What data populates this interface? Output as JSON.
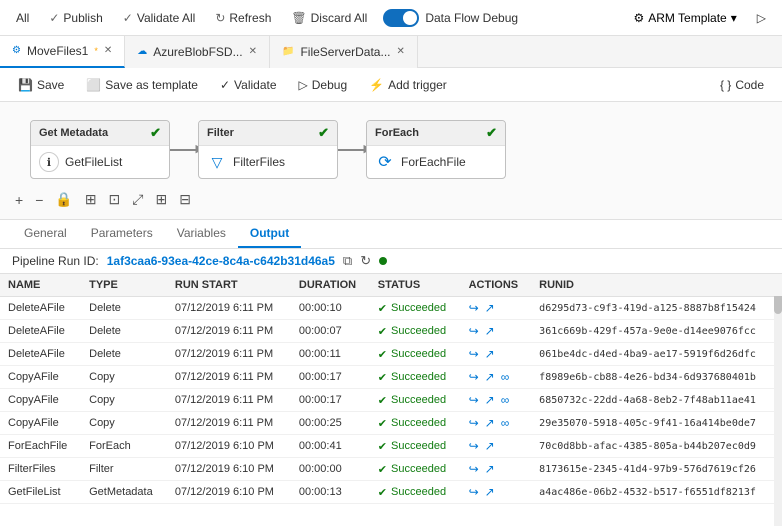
{
  "topToolbar": {
    "items": [
      {
        "label": "All"
      },
      {
        "label": "Publish"
      },
      {
        "label": "Validate All"
      },
      {
        "label": "Refresh"
      },
      {
        "label": "Discard All"
      }
    ],
    "toggle": {
      "label": "Data Flow Debug"
    },
    "armTemplate": {
      "label": "ARM Template"
    },
    "debugIcon": "▶"
  },
  "tabs": [
    {
      "id": "movefile",
      "label": "MoveFiles1",
      "active": true,
      "modified": true
    },
    {
      "id": "azureblob",
      "label": "AzureBlobFSD...",
      "active": false
    },
    {
      "id": "fileserver",
      "label": "FileServerData...",
      "active": false
    }
  ],
  "subToolbar": {
    "save": "Save",
    "saveAsTemplate": "Save as template",
    "validate": "Validate",
    "debug": "Debug",
    "addTrigger": "Add trigger",
    "code": "Code"
  },
  "nodes": [
    {
      "id": "getMetadata",
      "label": "Get Metadata",
      "body": "GetFileList",
      "iconType": "info"
    },
    {
      "id": "filter",
      "label": "Filter",
      "body": "FilterFiles",
      "iconType": "filter"
    },
    {
      "id": "forEach",
      "label": "ForEach",
      "body": "ForEachFile",
      "iconType": "foreach"
    }
  ],
  "canvasTools": [
    "+",
    "−",
    "🔒",
    "⊞",
    "⊡",
    "⤢",
    "⊞",
    "⊟"
  ],
  "panelTabs": [
    {
      "label": "General"
    },
    {
      "label": "Parameters"
    },
    {
      "label": "Variables"
    },
    {
      "label": "Output",
      "active": true
    }
  ],
  "pipelineRunBar": {
    "label": "Pipeline Run ID:",
    "runId": "1af3caa6-93ea-42ce-8c4a-c642b31d46a5"
  },
  "tableHeaders": [
    "NAME",
    "TYPE",
    "RUN START",
    "DURATION",
    "STATUS",
    "ACTIONS",
    "RUNID"
  ],
  "tableRows": [
    {
      "name": "DeleteAFile",
      "type": "Delete",
      "runStart": "07/12/2019 6:11 PM",
      "duration": "00:00:10",
      "status": "Succeeded",
      "runId": "d6295d73-c9f3-419d-a125-8887b8f15424"
    },
    {
      "name": "DeleteAFile",
      "type": "Delete",
      "runStart": "07/12/2019 6:11 PM",
      "duration": "00:00:07",
      "status": "Succeeded",
      "runId": "361c669b-429f-457a-9e0e-d14ee9076fcc"
    },
    {
      "name": "DeleteAFile",
      "type": "Delete",
      "runStart": "07/12/2019 6:11 PM",
      "duration": "00:00:11",
      "status": "Succeeded",
      "runId": "061be4dc-d4ed-4ba9-ae17-5919f6d26dfc"
    },
    {
      "name": "CopyAFile",
      "type": "Copy",
      "runStart": "07/12/2019 6:11 PM",
      "duration": "00:00:17",
      "status": "Succeeded",
      "hasExtra": true,
      "runId": "f8989e6b-cb88-4e26-bd34-6d937680401b"
    },
    {
      "name": "CopyAFile",
      "type": "Copy",
      "runStart": "07/12/2019 6:11 PM",
      "duration": "00:00:17",
      "status": "Succeeded",
      "hasExtra": true,
      "runId": "6850732c-22dd-4a68-8eb2-7f48ab11ae41"
    },
    {
      "name": "CopyAFile",
      "type": "Copy",
      "runStart": "07/12/2019 6:11 PM",
      "duration": "00:00:25",
      "status": "Succeeded",
      "hasExtra": true,
      "runId": "29e35070-5918-405c-9f41-16a414be0de7"
    },
    {
      "name": "ForEachFile",
      "type": "ForEach",
      "runStart": "07/12/2019 6:10 PM",
      "duration": "00:00:41",
      "status": "Succeeded",
      "runId": "70c0d8bb-afac-4385-805a-b44b207ec0d9"
    },
    {
      "name": "FilterFiles",
      "type": "Filter",
      "runStart": "07/12/2019 6:10 PM",
      "duration": "00:00:00",
      "status": "Succeeded",
      "runId": "8173615e-2345-41d4-97b9-576d7619cf26"
    },
    {
      "name": "GetFileList",
      "type": "GetMetadata",
      "runStart": "07/12/2019 6:10 PM",
      "duration": "00:00:13",
      "status": "Succeeded",
      "runId": "a4ac486e-06b2-4532-b517-f6551df8213f"
    }
  ]
}
